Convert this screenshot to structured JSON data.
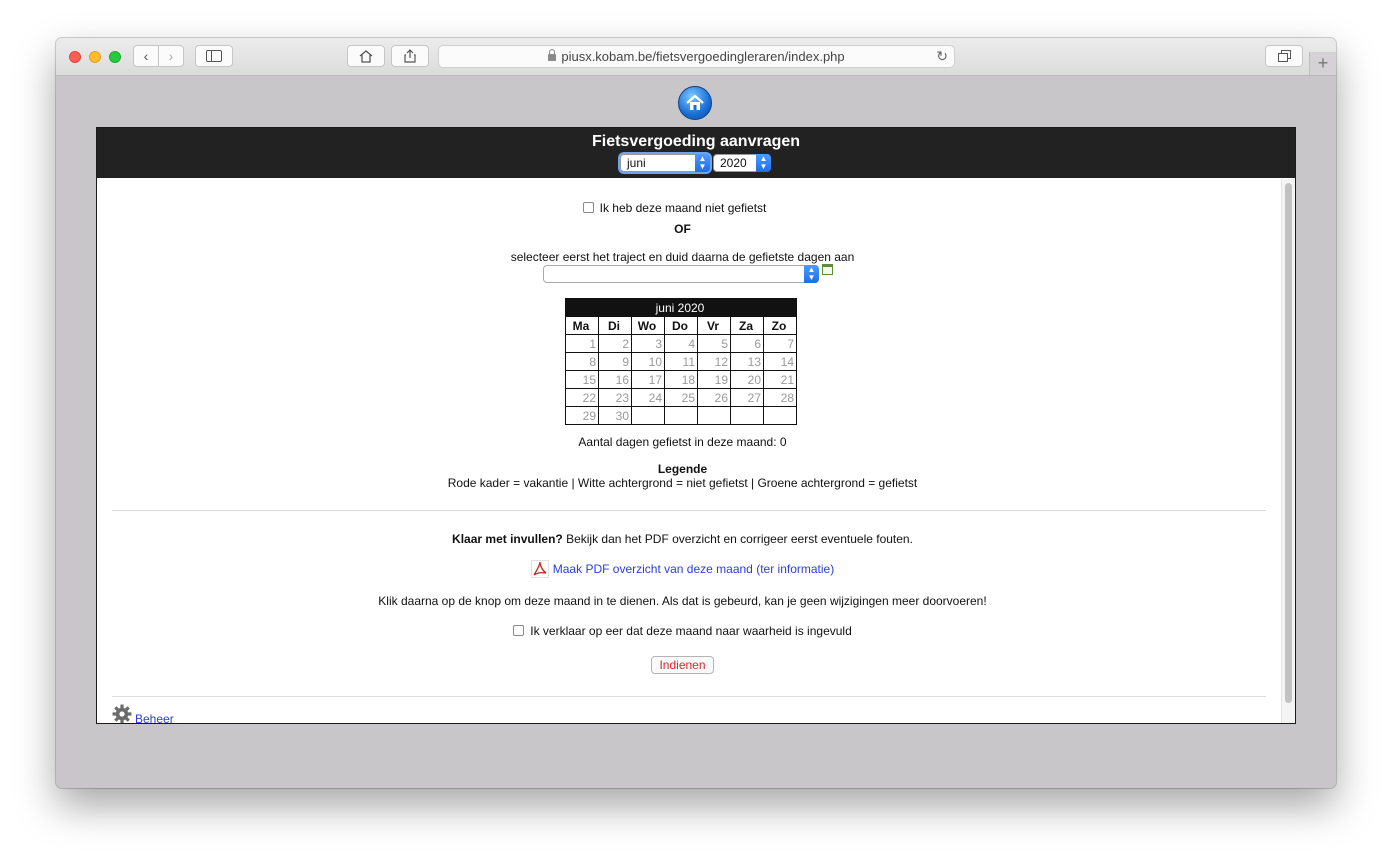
{
  "browser": {
    "url": "piusx.kobam.be/fietsvergoedingleraren/index.php",
    "new_tab_label": "+"
  },
  "header": {
    "title": "Fietsvergoeding aanvragen",
    "month_select": "juni",
    "year_select": "2020"
  },
  "form": {
    "not_cycled_label": "Ik heb deze maand niet gefietst",
    "or_label": "OF",
    "route_instruction": "selecteer eerst het traject en duid daarna de gefietste dagen aan",
    "route_select_value": ""
  },
  "calendar": {
    "title": "juni 2020",
    "days_of_week": [
      "Ma",
      "Di",
      "Wo",
      "Do",
      "Vr",
      "Za",
      "Zo"
    ],
    "weeks": [
      [
        "1",
        "2",
        "3",
        "4",
        "5",
        "6",
        "7"
      ],
      [
        "8",
        "9",
        "10",
        "11",
        "12",
        "13",
        "14"
      ],
      [
        "15",
        "16",
        "17",
        "18",
        "19",
        "20",
        "21"
      ],
      [
        "22",
        "23",
        "24",
        "25",
        "26",
        "27",
        "28"
      ],
      [
        "29",
        "30",
        "",
        "",
        "",
        "",
        ""
      ]
    ],
    "count_text": "Aantal dagen gefietst in deze maand: 0"
  },
  "legend": {
    "title": "Legende",
    "text": "Rode kader = vakantie | Witte achtergrond = niet gefietst | Groene achtergrond = gefietst"
  },
  "submit_section": {
    "done_bold": "Klaar met invullen?",
    "done_text": " Bekijk dan het PDF overzicht en corrigeer eerst eventuele fouten.",
    "pdf_link": "Maak PDF overzicht van deze maand (ter informatie)",
    "instruction": "Klik daarna op de knop om deze maand in te dienen. Als dat is gebeurd, kan je geen wijzigingen meer doorvoeren!",
    "declare_label": "Ik verklaar op eer dat deze maand naar waarheid is ingevuld",
    "submit_button": "Indienen"
  },
  "footer": {
    "beheer_link": "Beheer"
  },
  "icons": {
    "home": "home-icon",
    "pdf": "pdf-icon",
    "gear": "gear-icon",
    "calendar": "calendar-icon"
  }
}
